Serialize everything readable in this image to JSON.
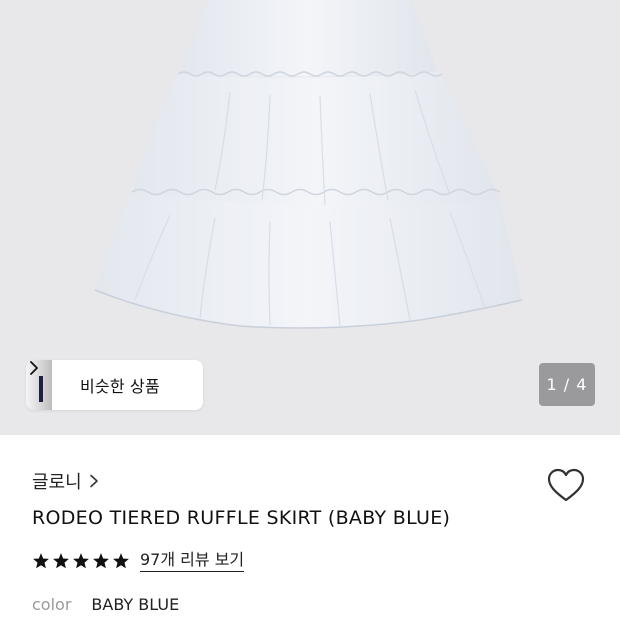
{
  "gallery": {
    "image_alt_name": "skirt-product-photo",
    "current_page": "1",
    "total_pages": "4",
    "page_indicator": "1 / 4",
    "similar_products_label": "비슷한 상품"
  },
  "product": {
    "brand": "글로니",
    "title": "RODEO TIERED RUFFLE SKIRT (BABY BLUE)",
    "rating_stars": 5,
    "review_link": "97개 리뷰 보기",
    "color_key": "color",
    "color_value": "BABY BLUE"
  },
  "colors": {
    "gallery_bg": "#e8e8ea",
    "skirt": "#eef1f6",
    "text": "#111111",
    "muted": "#9a9a9a",
    "indicator_bg": "#9a9a9c"
  },
  "icons": {
    "chevron": "chevron-right-icon",
    "heart": "heart-outline-icon",
    "star": "star-filled-icon"
  }
}
